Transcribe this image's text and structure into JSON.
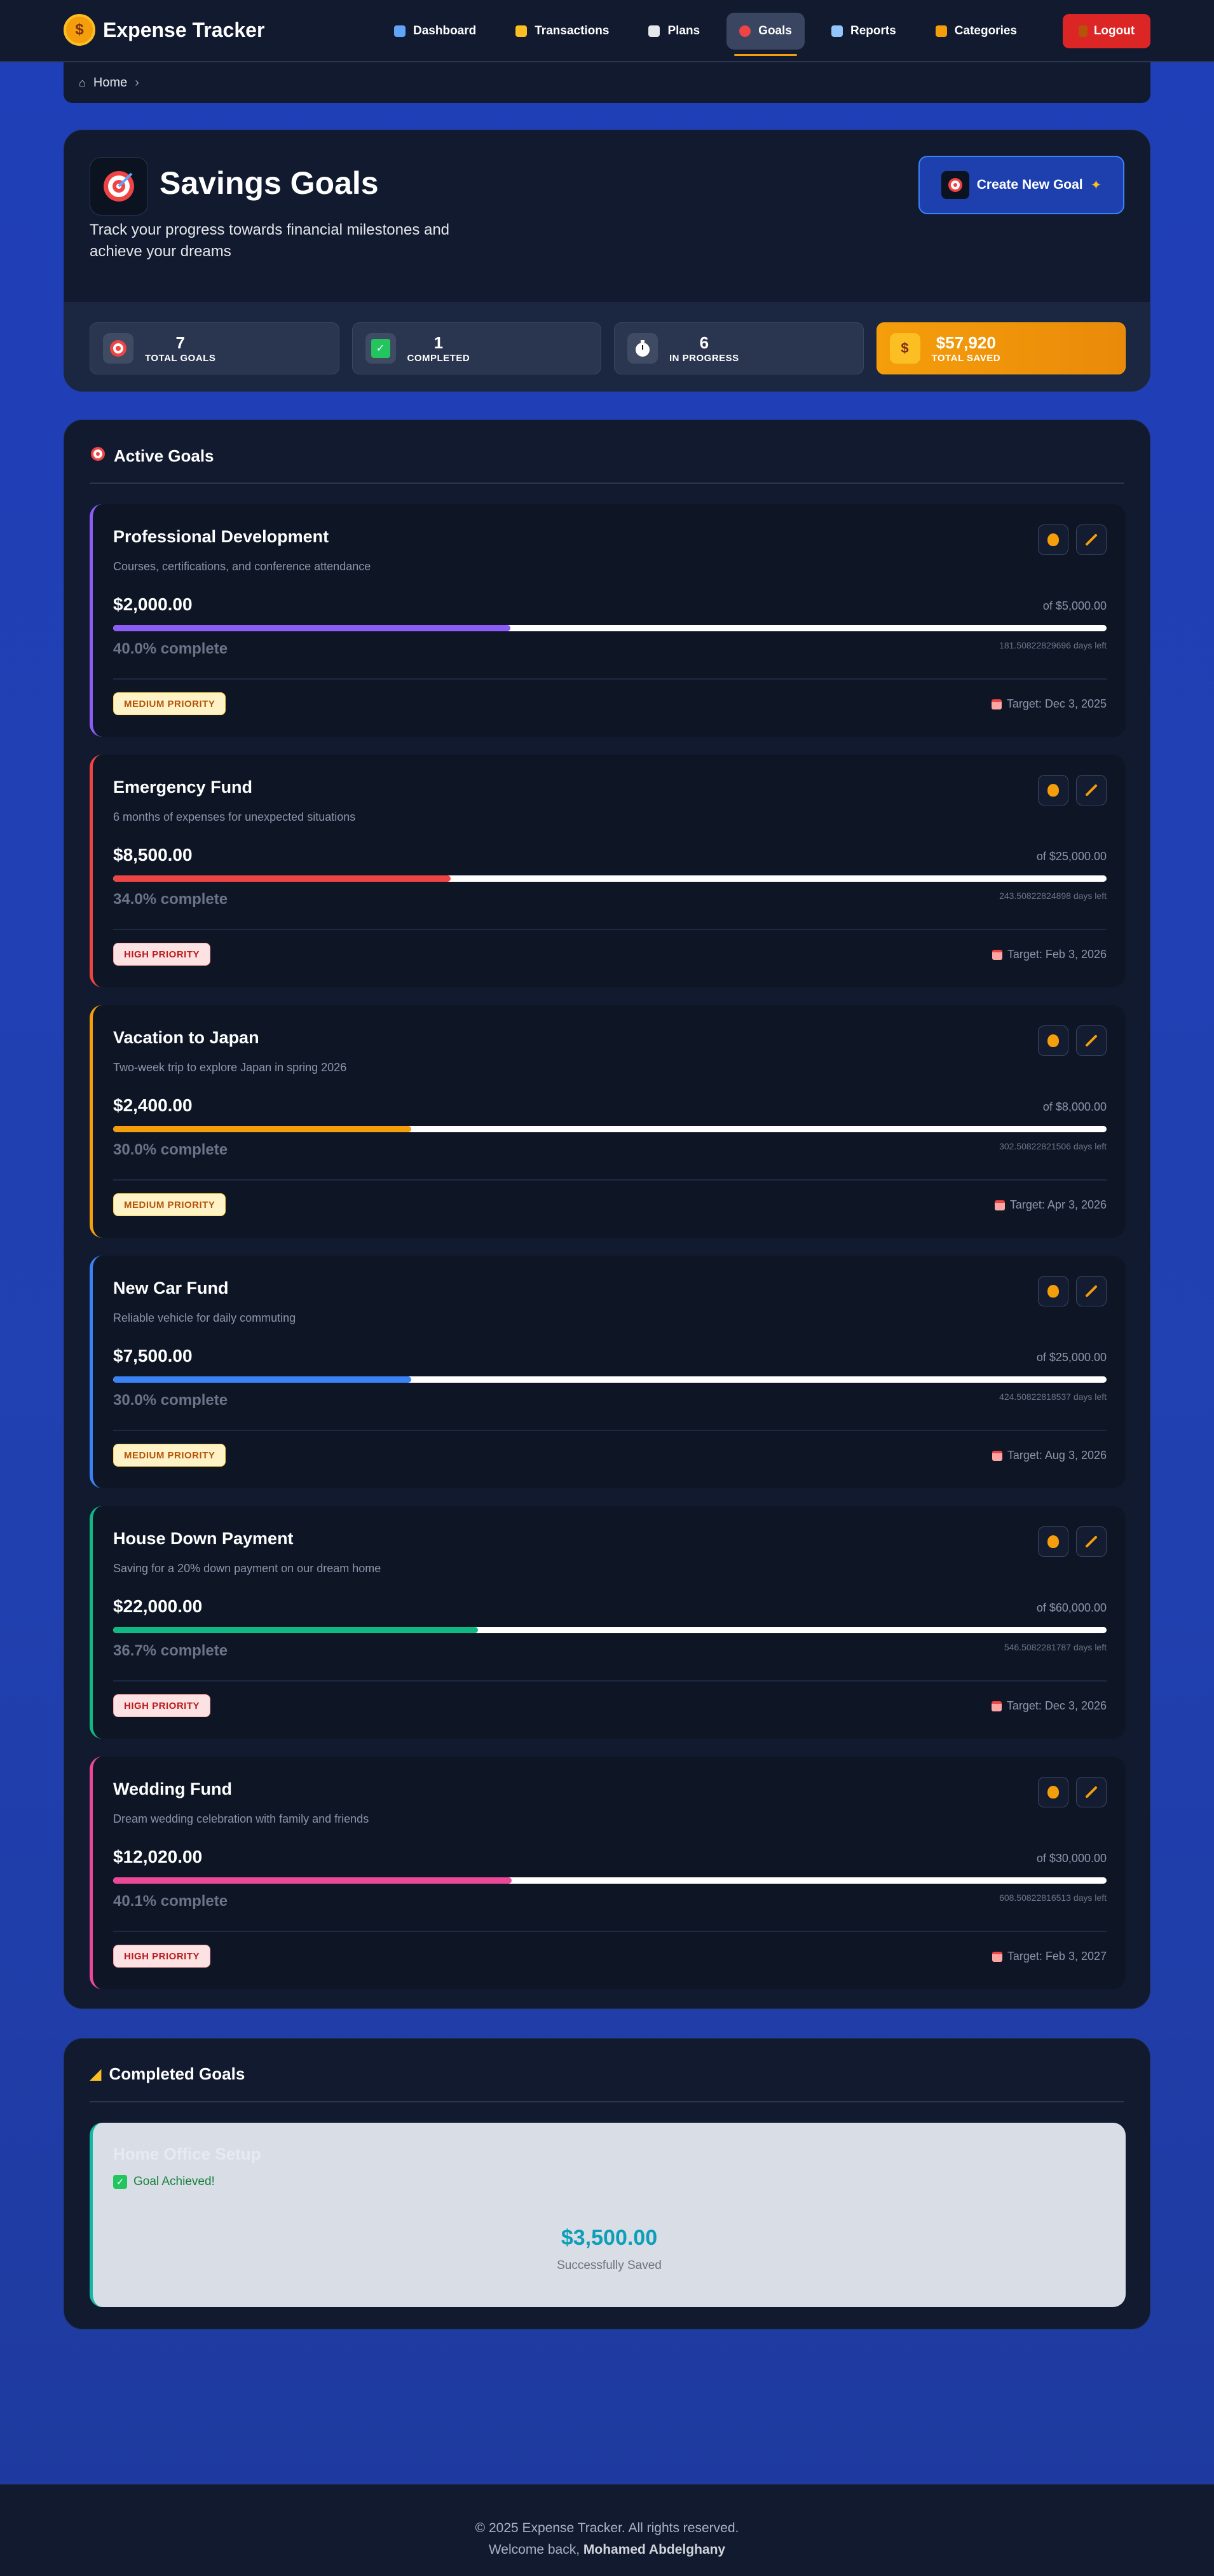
{
  "app": {
    "name": "Expense Tracker"
  },
  "nav": {
    "items": [
      {
        "label": "Dashboard"
      },
      {
        "label": "Transactions"
      },
      {
        "label": "Plans"
      },
      {
        "label": "Goals"
      },
      {
        "label": "Reports"
      },
      {
        "label": "Categories"
      }
    ],
    "active": "Goals",
    "logout": "Logout"
  },
  "breadcrumb": {
    "home": "Home"
  },
  "hero": {
    "title": "Savings Goals",
    "subtitle": "Track your progress towards financial milestones and achieve your dreams",
    "create_button": "Create New Goal"
  },
  "stats": [
    {
      "value": "7",
      "label": "TOTAL GOALS"
    },
    {
      "value": "1",
      "label": "COMPLETED"
    },
    {
      "value": "6",
      "label": "IN PROGRESS"
    },
    {
      "value": "$57,920",
      "label": "TOTAL SAVED"
    }
  ],
  "active_goals": {
    "heading": "Active Goals",
    "goals": [
      {
        "title": "Professional Development",
        "description": "Courses, certifications, and conference attendance",
        "amount": "$2,000.00",
        "target_amount": "of $5,000.00",
        "progress": 0.4,
        "percent_text": "40.0% complete",
        "days_left": "181.50822829696 days left",
        "priority": "MEDIUM PRIORITY",
        "target_date": "Target: Dec 3, 2025",
        "color": "#8b5cf6"
      },
      {
        "title": "Emergency Fund",
        "description": "6 months of expenses for unexpected situations",
        "amount": "$8,500.00",
        "target_amount": "of $25,000.00",
        "progress": 0.34,
        "percent_text": "34.0% complete",
        "days_left": "243.50822824898 days left",
        "priority": "HIGH PRIORITY",
        "target_date": "Target: Feb 3, 2026",
        "color": "#ef4444"
      },
      {
        "title": "Vacation to Japan",
        "description": "Two-week trip to explore Japan in spring 2026",
        "amount": "$2,400.00",
        "target_amount": "of $8,000.00",
        "progress": 0.3,
        "percent_text": "30.0% complete",
        "days_left": "302.50822821506 days left",
        "priority": "MEDIUM PRIORITY",
        "target_date": "Target: Apr 3, 2026",
        "color": "#f59e0b"
      },
      {
        "title": "New Car Fund",
        "description": "Reliable vehicle for daily commuting",
        "amount": "$7,500.00",
        "target_amount": "of $25,000.00",
        "progress": 0.3,
        "percent_text": "30.0% complete",
        "days_left": "424.50822818537 days left",
        "priority": "MEDIUM PRIORITY",
        "target_date": "Target: Aug 3, 2026",
        "color": "#3b82f6"
      },
      {
        "title": "House Down Payment",
        "description": "Saving for a 20% down payment on our dream home",
        "amount": "$22,000.00",
        "target_amount": "of $60,000.00",
        "progress": 0.367,
        "percent_text": "36.7% complete",
        "days_left": "546.5082281787 days left",
        "priority": "HIGH PRIORITY",
        "target_date": "Target: Dec 3, 2026",
        "color": "#10b981"
      },
      {
        "title": "Wedding Fund",
        "description": "Dream wedding celebration with family and friends",
        "amount": "$12,020.00",
        "target_amount": "of $30,000.00",
        "progress": 0.401,
        "percent_text": "40.1% complete",
        "days_left": "608.50822816513 days left",
        "priority": "HIGH PRIORITY",
        "target_date": "Target: Feb 3, 2027",
        "color": "#ec4899"
      }
    ]
  },
  "completed_goals": {
    "heading": "Completed Goals",
    "goals": [
      {
        "title": "Home Office Setup",
        "status": "Goal Achieved!",
        "amount": "$3,500.00",
        "label": "Successfully Saved"
      }
    ]
  },
  "footer": {
    "copyright": "© 2025 Expense Tracker. All rights reserved.",
    "welcome": "Welcome back,",
    "user": "Mohamed Abdelghany"
  }
}
